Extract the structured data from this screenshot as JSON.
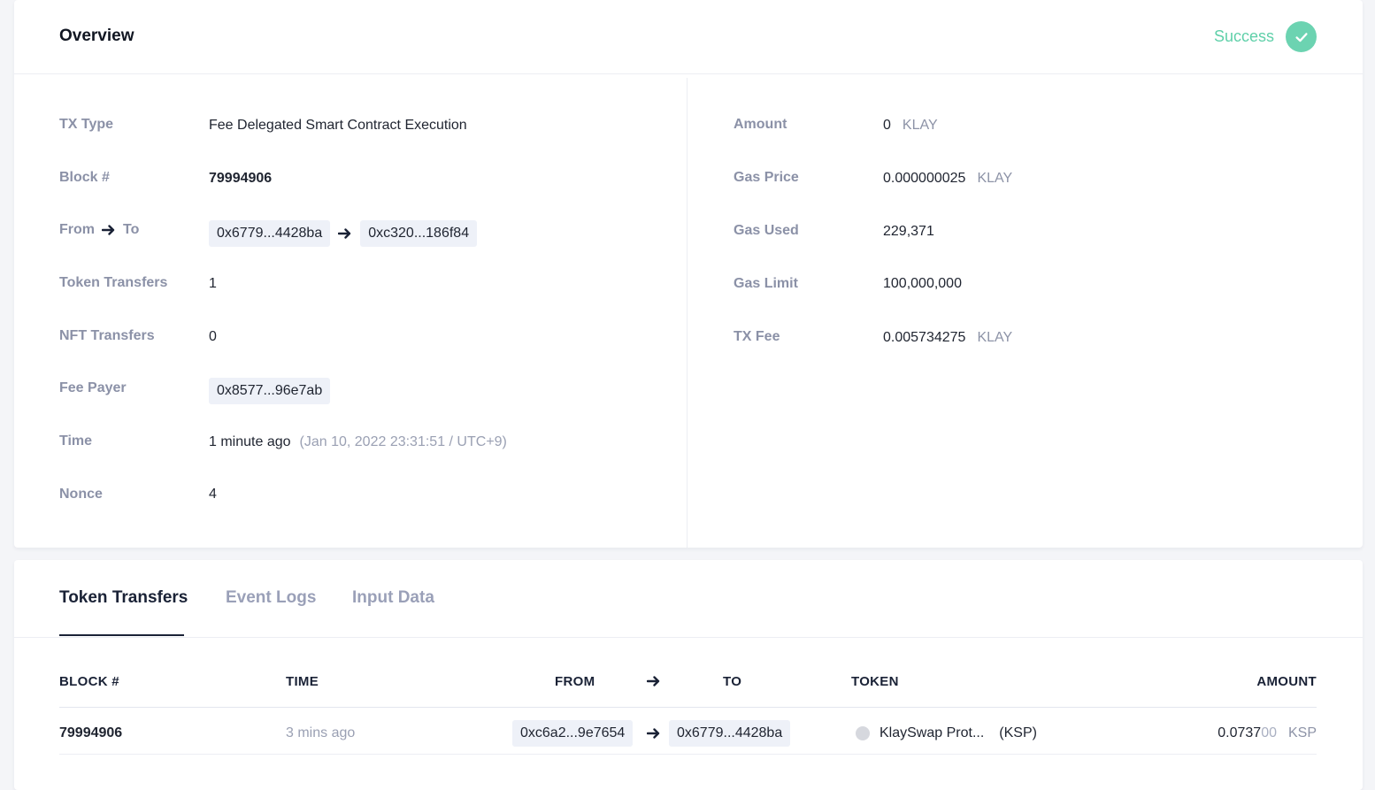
{
  "overview": {
    "title": "Overview",
    "status": {
      "label": "Success",
      "color": "#5fd0a9"
    },
    "left": {
      "tx_type": {
        "label": "TX Type",
        "value": "Fee Delegated Smart Contract Execution"
      },
      "block": {
        "label": "Block #",
        "value": "79994906"
      },
      "from_to": {
        "label_from": "From",
        "label_to": "To",
        "from": "0x6779...4428ba",
        "to": "0xc320...186f84"
      },
      "token_transfers": {
        "label": "Token Transfers",
        "value": "1"
      },
      "nft_transfers": {
        "label": "NFT Transfers",
        "value": "0"
      },
      "fee_payer": {
        "label": "Fee Payer",
        "value": "0x8577...96e7ab"
      },
      "time": {
        "label": "Time",
        "relative": "1 minute ago",
        "absolute": "(Jan 10, 2022 23:31:51 / UTC+9)"
      },
      "nonce": {
        "label": "Nonce",
        "value": "4"
      }
    },
    "right": {
      "amount": {
        "label": "Amount",
        "value": "0",
        "unit": "KLAY"
      },
      "gas_price": {
        "label": "Gas Price",
        "value": "0.000000025",
        "unit": "KLAY"
      },
      "gas_used": {
        "label": "Gas Used",
        "value": "229,371"
      },
      "gas_limit": {
        "label": "Gas Limit",
        "value": "100,000,000"
      },
      "tx_fee": {
        "label": "TX Fee",
        "value": "0.005734275",
        "unit": "KLAY"
      }
    }
  },
  "tabs": [
    {
      "label": "Token Transfers",
      "active": true
    },
    {
      "label": "Event Logs",
      "active": false
    },
    {
      "label": "Input Data",
      "active": false
    }
  ],
  "table": {
    "headers": {
      "block": "BLOCK #",
      "time": "TIME",
      "from": "FROM",
      "to": "TO",
      "token": "TOKEN",
      "amount": "AMOUNT"
    },
    "rows": [
      {
        "block": "79994906",
        "time": "3 mins ago",
        "from": "0xc6a2...9e7654",
        "to": "0x6779...4428ba",
        "token_name": "KlaySwap Prot...",
        "token_symbol": "(KSP)",
        "amount_main": "0.0737",
        "amount_trailing": "00",
        "amount_unit": "KSP"
      }
    ]
  },
  "icons": {
    "status": "check-icon",
    "arrow": "arrow-right-icon",
    "token": "token-icon"
  }
}
